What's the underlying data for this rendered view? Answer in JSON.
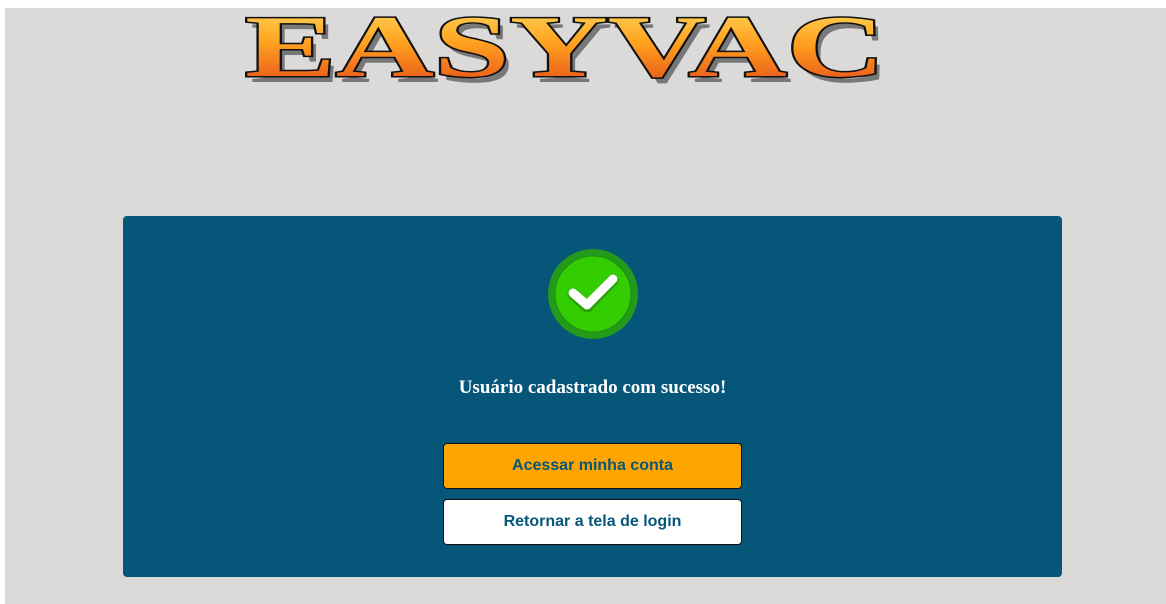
{
  "logo": {
    "text": "EASYVAC"
  },
  "success": {
    "icon": "check-circle-icon",
    "message": "Usuário cadastrado com sucesso!"
  },
  "actions": {
    "access_account_label": "Acessar minha conta",
    "back_to_login_label": "Retornar a tela de login"
  },
  "colors": {
    "page_background": "#dcd9d9",
    "card_background": "#06567a",
    "primary_button": "#ffa500",
    "secondary_button": "#ffffff",
    "button_text": "#06567a",
    "check_green": "#33cc00"
  }
}
